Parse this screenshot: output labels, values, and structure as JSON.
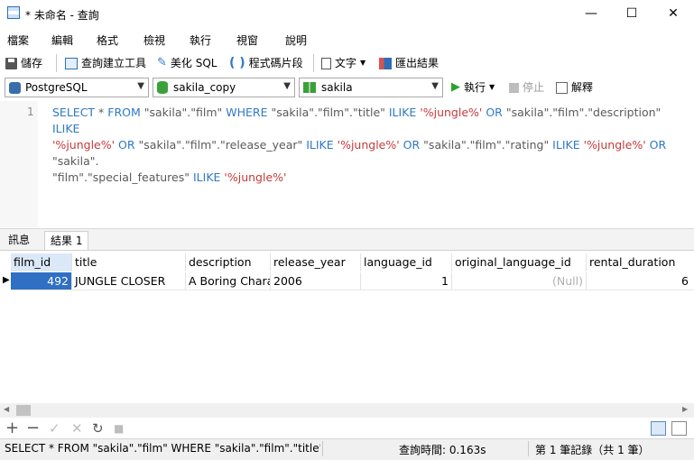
{
  "window": {
    "title": "* 未命名 - 查詢",
    "minimize": "—",
    "maximize": "☐",
    "close": "✕"
  },
  "menu": [
    "檔案",
    "編輯",
    "格式",
    "檢視",
    "執行",
    "視窗",
    "說明"
  ],
  "toolbar": {
    "save": "儲存",
    "query_builder": "查詢建立工具",
    "beautify": "美化 SQL",
    "snippet": "程式碼片段",
    "text": "文字",
    "export": "匯出結果"
  },
  "connection": {
    "server": "PostgreSQL",
    "database": "sakila_copy",
    "schema": "sakila",
    "run": "執行",
    "stop": "停止",
    "explain": "解釋"
  },
  "editor": {
    "line_number": "1",
    "sql_parts": [
      [
        "kw",
        "SELECT"
      ],
      [
        "t",
        " * "
      ],
      [
        "kw",
        "FROM"
      ],
      [
        "t",
        " \"sakila\".\"film\" "
      ],
      [
        "kw",
        "WHERE"
      ],
      [
        "t",
        " \"sakila\".\"film\".\"title\" "
      ],
      [
        "kw",
        "ILIKE"
      ],
      [
        "t",
        " "
      ],
      [
        "str",
        "'%jungle%'"
      ],
      [
        "t",
        " "
      ],
      [
        "kw",
        "OR"
      ],
      [
        "t",
        " \"sakila\".\"film\".\"description\" "
      ],
      [
        "kw",
        "ILIKE"
      ],
      [
        "t",
        "\n"
      ],
      [
        "str",
        "'%jungle%'"
      ],
      [
        "t",
        " "
      ],
      [
        "kw",
        "OR"
      ],
      [
        "t",
        " \"sakila\".\"film\".\"release_year\" "
      ],
      [
        "kw",
        "ILIKE"
      ],
      [
        "t",
        " "
      ],
      [
        "str",
        "'%jungle%'"
      ],
      [
        "t",
        " "
      ],
      [
        "kw",
        "OR"
      ],
      [
        "t",
        " \"sakila\".\"film\".\"rating\" "
      ],
      [
        "kw",
        "ILIKE"
      ],
      [
        "t",
        " "
      ],
      [
        "str",
        "'%jungle%'"
      ],
      [
        "t",
        " "
      ],
      [
        "kw",
        "OR"
      ],
      [
        "t",
        " \"sakila\".\n\"film\".\"special_features\" "
      ],
      [
        "kw",
        "ILIKE"
      ],
      [
        "t",
        " "
      ],
      [
        "str",
        "'%jungle%'"
      ]
    ]
  },
  "tabs": [
    "訊息",
    "結果 1"
  ],
  "grid": {
    "columns": [
      "film_id",
      "title",
      "description",
      "release_year",
      "language_id",
      "original_language_id",
      "rental_duration"
    ],
    "row": [
      "492",
      "JUNGLE CLOSER",
      "A Boring Charac",
      "2006",
      "1",
      "(Null)",
      "6"
    ],
    "row_marker": "▶"
  },
  "gridbar": {
    "add": "+",
    "delete": "−",
    "apply": "✓",
    "discard": "✕",
    "refresh": "↻",
    "stop": "■"
  },
  "status": {
    "sql": "SELECT * FROM \"sakila\".\"film\" WHERE \"sakila\".\"film\".\"title\" ILIKE",
    "time": "查詢時間: 0.163s",
    "records": "第 1 筆記錄（共 1 筆）"
  }
}
